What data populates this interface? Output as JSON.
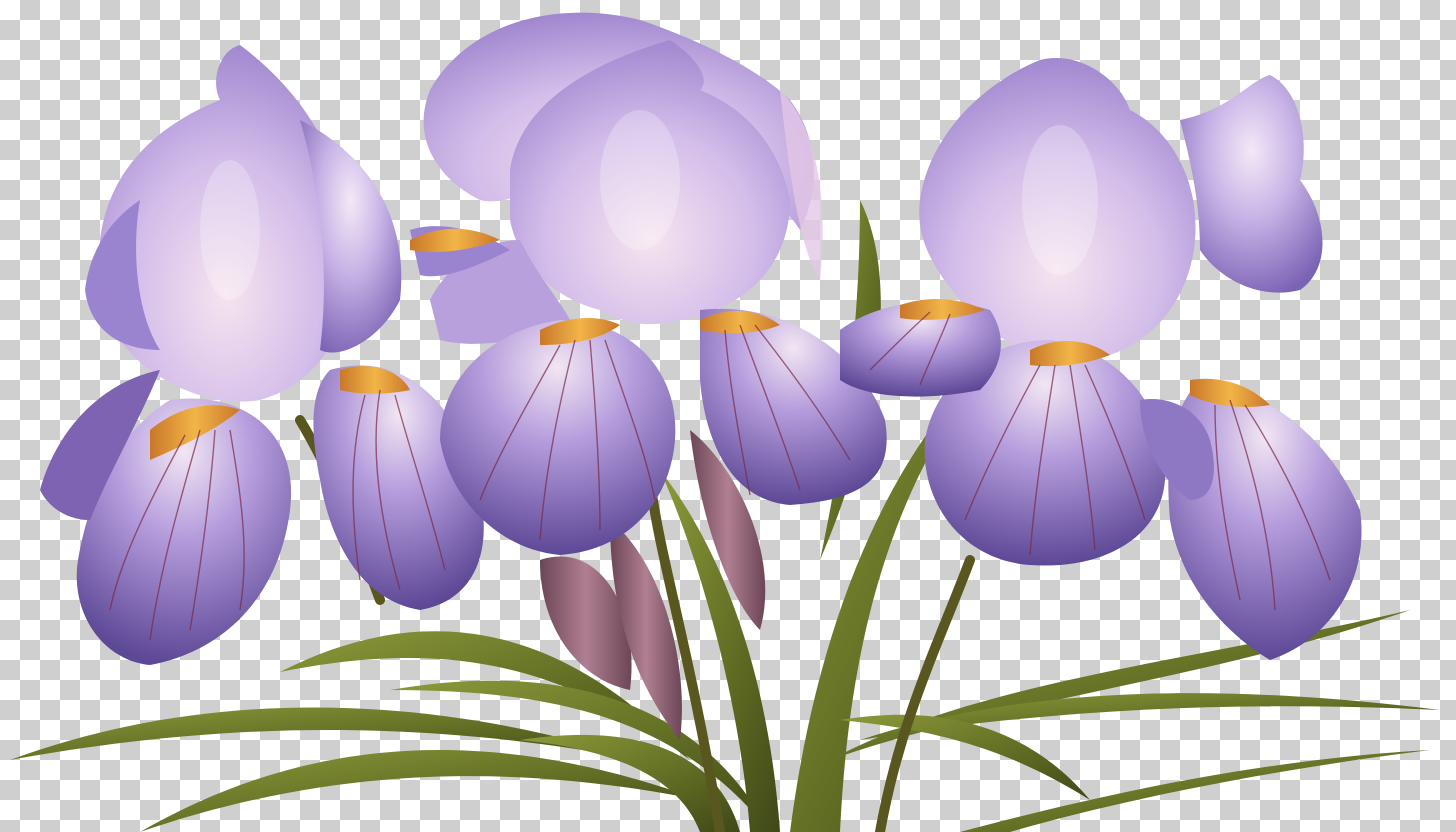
{
  "image": {
    "subject": "iris-bouquet",
    "background": "transparency-checkerboard",
    "colors": {
      "checker_light": "#ffffff",
      "checker_dark": "#cfcfcf",
      "petal_light": "#d9c6ee",
      "petal_mid": "#a98fd6",
      "petal_dark": "#6e56a8",
      "petal_pink": "#e6c3e3",
      "beard": "#e9a13b",
      "vein": "#7a2a4a",
      "leaf": "#6f7a2a",
      "leaf_dark": "#3f4818",
      "bud": "#9a6a7e"
    },
    "flowers": [
      {
        "name": "left-iris"
      },
      {
        "name": "center-iris"
      },
      {
        "name": "back-iris"
      },
      {
        "name": "right-iris"
      }
    ]
  }
}
